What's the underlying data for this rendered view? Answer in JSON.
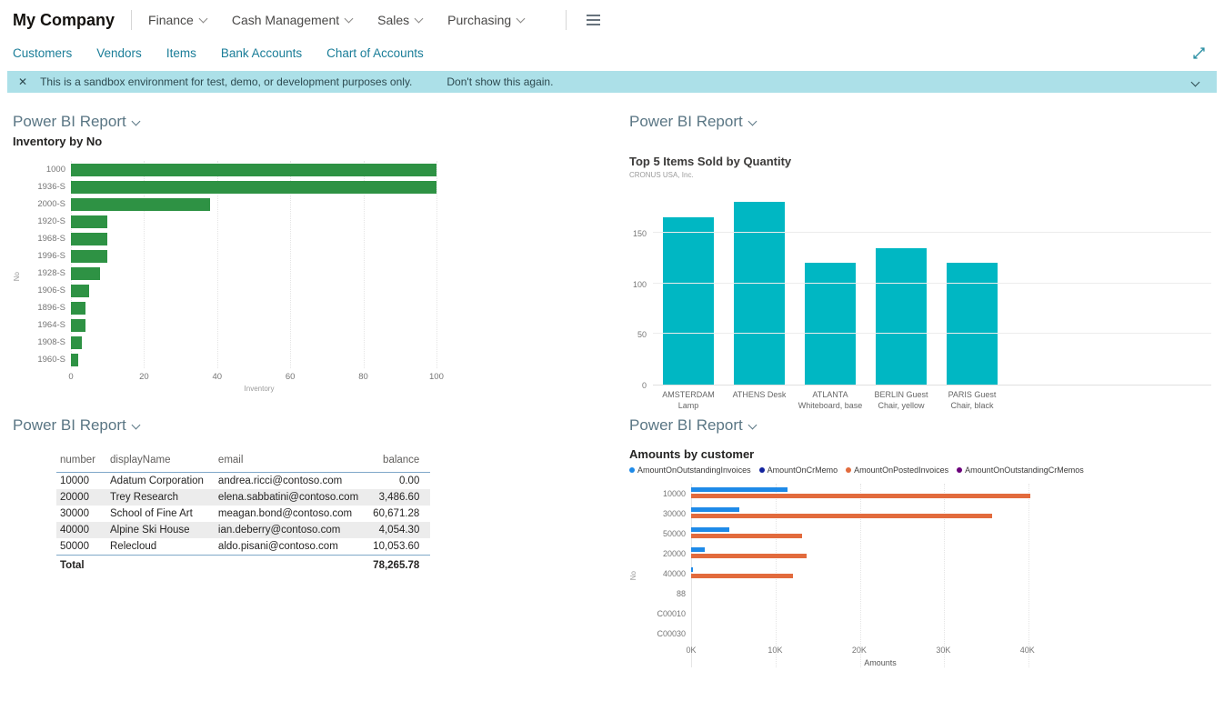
{
  "header": {
    "company": "My Company",
    "menus": [
      "Finance",
      "Cash Management",
      "Sales",
      "Purchasing"
    ]
  },
  "navbar": {
    "links": [
      "Customers",
      "Vendors",
      "Items",
      "Bank Accounts",
      "Chart of Accounts"
    ]
  },
  "banner": {
    "message": "This is a sandbox environment for test, demo, or development purposes only.",
    "action": "Don't show this again."
  },
  "panel_header_label": "Power BI Report",
  "icons": {
    "close": "✕"
  },
  "colors": {
    "link": "#1a7d98",
    "banner_bg": "#ace0e8",
    "panel_header": "#5a7684"
  },
  "chart_data": [
    {
      "type": "bar",
      "orientation": "horizontal",
      "title": "Inventory by No",
      "xlabel": "Inventory",
      "ylabel": "No",
      "categories": [
        "1000",
        "1936-S",
        "2000-S",
        "1920-S",
        "1968-S",
        "1996-S",
        "1928-S",
        "1906-S",
        "1896-S",
        "1964-S",
        "1908-S",
        "1960-S"
      ],
      "values": [
        100,
        100,
        38,
        10,
        10,
        10,
        8,
        5,
        4,
        4,
        3,
        2
      ],
      "xticks": [
        0,
        20,
        40,
        60,
        80,
        100
      ],
      "xlim": [
        0,
        103
      ],
      "color": "#2e9244",
      "grid": "vertical-dotted"
    },
    {
      "type": "bar",
      "orientation": "vertical",
      "title": "Top 5 Items Sold by Quantity",
      "subtitle": "CRONUS USA, Inc.",
      "categories": [
        "AMSTERDAM Lamp",
        "ATHENS Desk",
        "ATLANTA Whiteboard, base",
        "BERLIN Guest Chair, yellow",
        "PARIS Guest Chair, black"
      ],
      "values": [
        165,
        180,
        120,
        135,
        120
      ],
      "yticks": [
        0,
        50,
        100,
        150
      ],
      "ylim": [
        0,
        192
      ],
      "color": "#00b7c3",
      "grid": "horizontal"
    },
    {
      "type": "table",
      "columns": [
        "number",
        "displayName",
        "email",
        "balance"
      ],
      "rows": [
        [
          "10000",
          "Adatum Corporation",
          "andrea.ricci@contoso.com",
          "0.00"
        ],
        [
          "20000",
          "Trey Research",
          "elena.sabbatini@contoso.com",
          "3,486.60"
        ],
        [
          "30000",
          "School of Fine Art",
          "meagan.bond@contoso.com",
          "60,671.28"
        ],
        [
          "40000",
          "Alpine Ski House",
          "ian.deberry@contoso.com",
          "4,054.30"
        ],
        [
          "50000",
          "Relecloud",
          "aldo.pisani@contoso.com",
          "10,053.60"
        ]
      ],
      "total_label": "Total",
      "total_value": "78,265.78"
    },
    {
      "type": "bar",
      "orientation": "horizontal",
      "grouped": true,
      "title": "Amounts by customer",
      "xlabel": "Amounts",
      "ylabel": "No",
      "categories": [
        "10000",
        "30000",
        "50000",
        "20000",
        "40000",
        "88",
        "C00010",
        "C00030"
      ],
      "series": [
        {
          "name": "AmountOnOutstandingInvoices",
          "color": "#1e8ae8",
          "values": [
            11500,
            5700,
            4500,
            1600,
            250,
            0,
            0,
            0
          ]
        },
        {
          "name": "AmountOnCrMemo",
          "color": "#12239e",
          "values": [
            0,
            0,
            0,
            0,
            0,
            0,
            0,
            0
          ]
        },
        {
          "name": "AmountOnPostedInvoices",
          "color": "#e26b3d",
          "values": [
            40300,
            35800,
            13200,
            13700,
            12100,
            0,
            0,
            0
          ]
        },
        {
          "name": "AmountOnOutstandingCrMemos",
          "color": "#6b007b",
          "values": [
            0,
            0,
            0,
            0,
            0,
            0,
            0,
            0
          ]
        }
      ],
      "xticks": [
        "0K",
        "10K",
        "20K",
        "30K",
        "40K"
      ],
      "xtick_values": [
        0,
        10000,
        20000,
        30000,
        40000
      ],
      "xlim": [
        0,
        45000
      ],
      "grid": "vertical-dotted"
    }
  ]
}
